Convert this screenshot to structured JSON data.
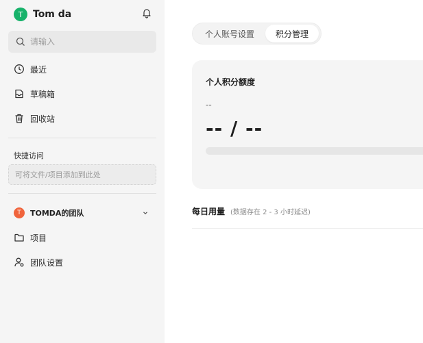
{
  "user": {
    "initial": "T",
    "name": "Tom da"
  },
  "search": {
    "placeholder": "请输入"
  },
  "nav": [
    {
      "label": "最近",
      "icon": "clock-icon"
    },
    {
      "label": "草稿箱",
      "icon": "drafts-icon"
    },
    {
      "label": "回收站",
      "icon": "trash-icon"
    }
  ],
  "quick_access": {
    "title": "快捷访问",
    "hint": "可将文件/项目添加到此处"
  },
  "team": {
    "initial": "T",
    "name": "TOMDA的团队",
    "items": [
      {
        "label": "项目",
        "icon": "folder-icon"
      },
      {
        "label": "团队设置",
        "icon": "user-settings-icon"
      }
    ]
  },
  "tabs": [
    {
      "label": "个人账号设置",
      "active": false
    },
    {
      "label": "积分管理",
      "active": true
    }
  ],
  "credits": {
    "title": "个人积分额度",
    "sub_value": "--",
    "main_value": "-- / --",
    "progress_fraction": 0
  },
  "daily": {
    "title": "每日用量",
    "note": "(数据存在 2 - 3 小时延迟)"
  },
  "colors": {
    "user_avatar": "#17b26a",
    "team_avatar": "#f0643c",
    "sidebar_bg": "#f5f5f5"
  }
}
